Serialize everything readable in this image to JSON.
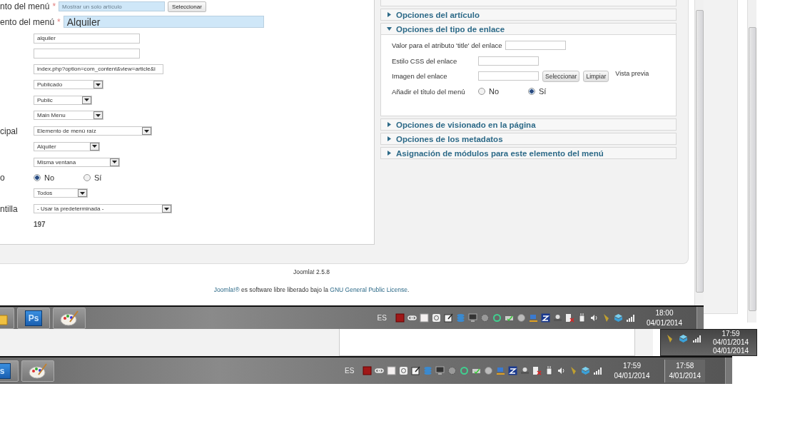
{
  "form": {
    "rows": [
      {
        "kind": "picker",
        "label": "nto del menú",
        "required_mark": "*",
        "value": "Mostrar un solo artículo",
        "button": "Seleccionar"
      },
      {
        "kind": "title",
        "label": "ento del menú",
        "required_mark": "*",
        "value": "Alquiler"
      },
      {
        "kind": "text",
        "value": "alquiler"
      },
      {
        "kind": "text"
      },
      {
        "kind": "text",
        "value": "index.php?option=com_content&view=article&i"
      },
      {
        "kind": "select",
        "value": "Publicado"
      },
      {
        "kind": "select",
        "value": "Public"
      },
      {
        "kind": "select",
        "value": "Main Menu"
      },
      {
        "kind": "select",
        "label": "cipal",
        "value": "Elemento de menú raíz"
      },
      {
        "kind": "select",
        "value": "Alquiler"
      },
      {
        "kind": "select",
        "value": "Misma ventana"
      },
      {
        "kind": "radio",
        "label": "o",
        "options": [
          {
            "label": "No",
            "selected": true
          },
          {
            "label": "Sí",
            "selected": false
          }
        ]
      },
      {
        "kind": "select",
        "value": "Todos"
      },
      {
        "kind": "select",
        "label": "ntilla",
        "value": "- Usar la predeterminada -"
      },
      {
        "kind": "static",
        "value": "197"
      }
    ]
  },
  "accordion": [
    {
      "title": "Opciones del artículo",
      "expanded": false
    },
    {
      "title": "Opciones del tipo de enlace",
      "expanded": true,
      "fields": [
        {
          "kind": "text",
          "label": "Valor para el atributo 'title' del enlace"
        },
        {
          "kind": "text",
          "label": "Estilo CSS del enlace"
        },
        {
          "kind": "image",
          "label": "Imagen del enlace",
          "buttons": [
            "Seleccionar",
            "Limpiar"
          ],
          "preview": "Vista previa"
        },
        {
          "kind": "radio",
          "label": "Añadir el título del menú",
          "options": [
            {
              "label": "No",
              "selected": false
            },
            {
              "label": "Sí",
              "selected": true
            }
          ]
        }
      ]
    },
    {
      "title": "Opciones de visionado en la página",
      "expanded": false
    },
    {
      "title": "Opciones de los metadatos",
      "expanded": false
    },
    {
      "title": "Asignación de módulos para este elemento del menú",
      "expanded": false
    }
  ],
  "footer": {
    "version": "Joomla! 2.5.8",
    "license": [
      {
        "text": "Joomla!®",
        "link": true
      },
      {
        "text": " es software libre liberado bajo la ",
        "link": false
      },
      {
        "text": "GNU General Public License",
        "link": true
      }
    ],
    "end": "."
  },
  "taskbars": [
    {
      "ps": "Ps",
      "language": "ES",
      "clocks": [
        {
          "time": "18:00",
          "date": "04/01/2014"
        }
      ]
    },
    {
      "ps": "s",
      "language": "ES",
      "clocks": [
        {
          "time": "17:59",
          "date": "04/01/2014"
        },
        {
          "time": "17:58",
          "date": "4/01/2014"
        }
      ]
    }
  ],
  "clock_popup": {
    "time": "17:59",
    "date": "04/01/2014",
    "date_behind": "04/01/2014"
  }
}
